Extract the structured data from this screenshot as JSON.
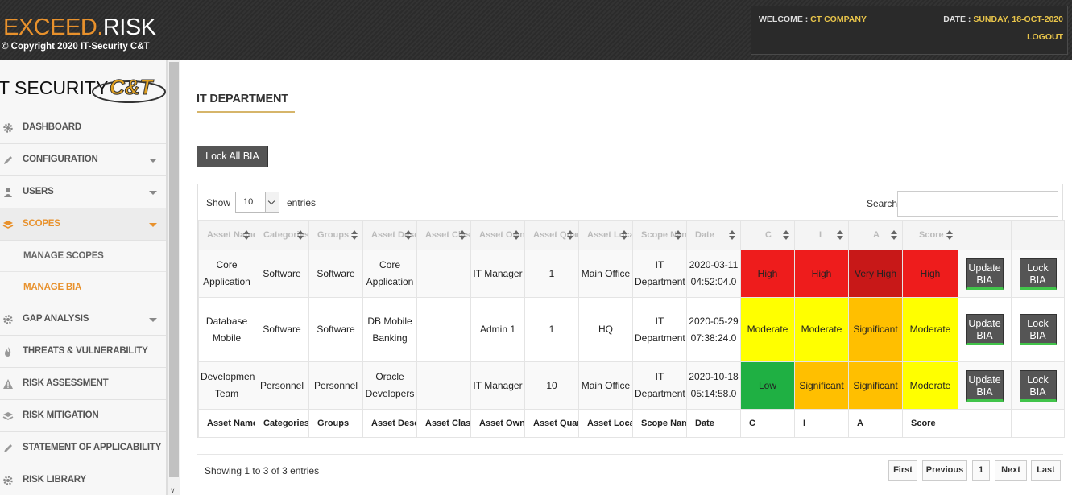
{
  "header": {
    "brand_part1": "EXCEED.",
    "brand_part2": "RISK",
    "copyright": "© Copyright 2020 IT-Security C&T",
    "welcome_label": "WELCOME : ",
    "welcome_value": "CT COMPANY",
    "date_label": "DATE : ",
    "date_value": "SUNDAY, 18-OCT-2020",
    "logout": "LOGOUT"
  },
  "logo": {
    "text": "T SECURITY",
    "emblem": "C&T"
  },
  "sidebar": {
    "items": [
      {
        "label": "DASHBOARD",
        "icon": "gear-icon"
      },
      {
        "label": "CONFIGURATION",
        "icon": "pencil-icon"
      },
      {
        "label": "USERS",
        "icon": "user-icon"
      },
      {
        "label": "SCOPES",
        "icon": "layers-icon"
      },
      {
        "label": "MANAGE SCOPES"
      },
      {
        "label": "MANAGE BIA"
      },
      {
        "label": "GAP ANALYSIS",
        "icon": "gear-icon"
      },
      {
        "label": "THREATS & VULNERABILITY",
        "icon": "fire-icon"
      },
      {
        "label": "RISK ASSESSMENT",
        "icon": "warning-icon"
      },
      {
        "label": "RISK MITIGATION",
        "icon": "layers-icon"
      },
      {
        "label": "STATEMENT OF APPLICABILITY",
        "icon": "pencil-icon"
      },
      {
        "label": "RISK LIBRARY",
        "icon": "gear-icon"
      }
    ]
  },
  "main": {
    "title": "IT DEPARTMENT",
    "lock_all": "Lock All BIA",
    "show_label": "Show",
    "entries_value": "10",
    "entries_label": "entries",
    "search_label": "Search:",
    "search_value": "",
    "columns": [
      "Asset Name",
      "Categories",
      "Groups",
      "Asset Description",
      "Asset Classification",
      "Asset Owner",
      "Asset Quantity",
      "Asset Location",
      "Scope Name",
      "Date",
      "C",
      "I",
      "A",
      "Score"
    ],
    "rows": [
      {
        "asset_name": "Core Application",
        "categories": "Software",
        "groups": "Software",
        "description": "Core Application",
        "classification": "",
        "owner": "IT Manager",
        "quantity": "1",
        "location": "Main Office",
        "scope": "IT Department",
        "date": "2020-03-11 04:52:04.0",
        "c": "High",
        "i": "High",
        "a": "Very High",
        "score": "High",
        "update": "Update BIA",
        "lock": "Lock BIA"
      },
      {
        "asset_name": "Database Mobile",
        "categories": "Software",
        "groups": "Software",
        "description": "DB Mobile Banking",
        "classification": "",
        "owner": "Admin 1",
        "quantity": "1",
        "location": "HQ",
        "scope": "IT Department",
        "date": "2020-05-29 07:38:24.0",
        "c": "Moderate",
        "i": "Moderate",
        "a": "Significant",
        "score": "Moderate",
        "update": "Update BIA",
        "lock": "Lock BIA"
      },
      {
        "asset_name": "Development Team",
        "categories": "Personnel",
        "groups": "Personnel",
        "description": "Oracle Developers",
        "classification": "",
        "owner": "IT Manager",
        "quantity": "10",
        "location": "Main Office",
        "scope": "IT Department",
        "date": "2020-10-18 05:14:58.0",
        "c": "Low",
        "i": "Significant",
        "a": "Significant",
        "score": "Moderate",
        "update": "Update BIA",
        "lock": "Lock BIA"
      }
    ],
    "showing": "Showing 1 to 3 of 3 entries",
    "pagination": {
      "first": "First",
      "previous": "Previous",
      "page": "1",
      "next": "Next",
      "last": "Last"
    }
  },
  "colors": {
    "accent": "#e8912c",
    "high": "#ee1c1c",
    "very_high": "#c81818",
    "moderate": "#ffff00",
    "significant": "#ffbf00",
    "low": "#1fb043"
  }
}
